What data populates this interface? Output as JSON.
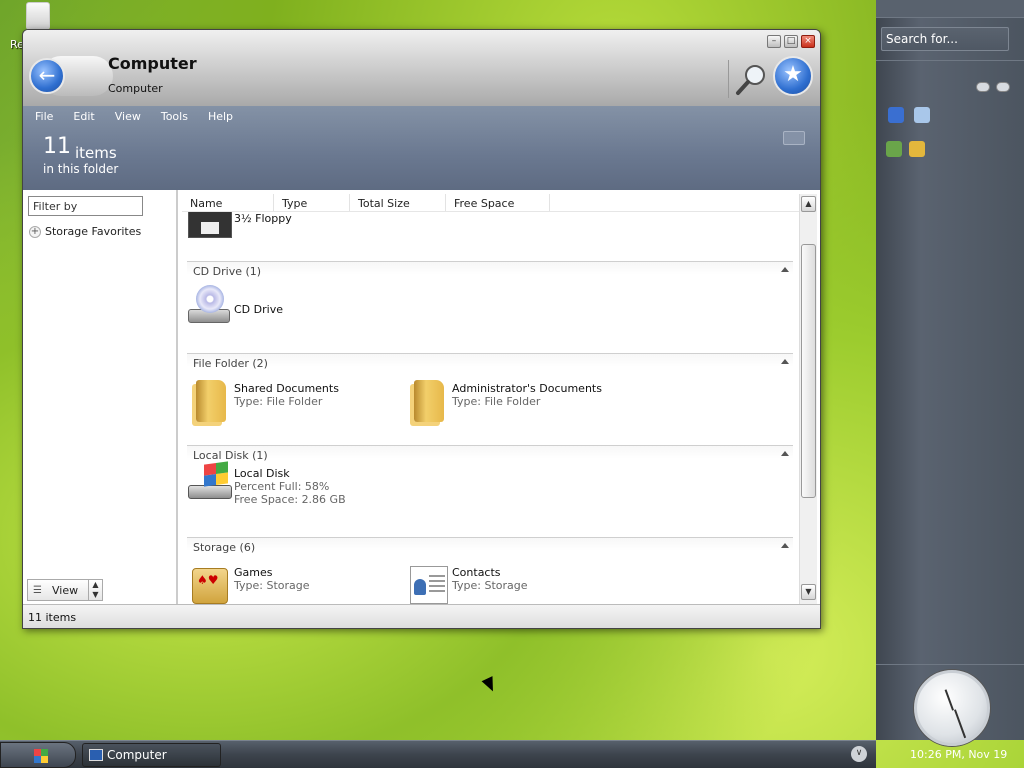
{
  "desktop": {
    "recycle_label": "Re"
  },
  "window": {
    "title": "Computer",
    "subtitle": "Computer",
    "menu": [
      "File",
      "Edit",
      "View",
      "Tools",
      "Help"
    ],
    "header": {
      "count": "11",
      "count_word": "items",
      "subtitle": "in this folder"
    },
    "left_pane": {
      "filter_placeholder": "Filter by",
      "storage_favorites": "Storage Favorites",
      "view_label": "View"
    },
    "columns": [
      "Name",
      "Type",
      "Total Size",
      "Free Space"
    ],
    "top_item": {
      "name": "3½ Floppy"
    },
    "groups": [
      {
        "title": "CD Drive (1)",
        "items": [
          {
            "name": "CD Drive",
            "details": []
          }
        ]
      },
      {
        "title": "File Folder (2)",
        "items": [
          {
            "name": "Shared Documents",
            "details": [
              "Type: File Folder"
            ]
          },
          {
            "name": "Administrator's Documents",
            "details": [
              "Type: File Folder"
            ]
          }
        ]
      },
      {
        "title": "Local Disk (1)",
        "items": [
          {
            "name": "Local Disk",
            "details": [
              "Percent Full: 58%",
              "Free Space: 2.86 GB"
            ]
          }
        ]
      },
      {
        "title": "Storage (6)",
        "items": [
          {
            "name": "Games",
            "details": [
              "Type: Storage"
            ]
          },
          {
            "name": "Contacts",
            "details": [
              "Type: Storage"
            ]
          }
        ]
      }
    ],
    "status_text": "11 items"
  },
  "sidebar": {
    "search_placeholder": "Search for...",
    "clock_text": "10:26 PM, Nov 19"
  },
  "taskbar": {
    "task_label": "Computer"
  }
}
